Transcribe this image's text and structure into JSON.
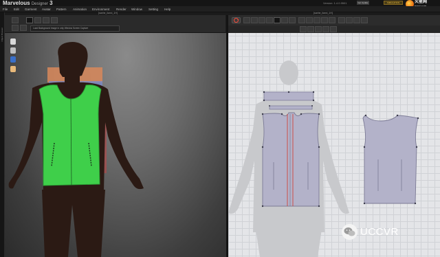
{
  "app": {
    "name": "Marvelous",
    "suffix": "Designer",
    "version_num": "3",
    "version_text": "Version: 1.4.0.9501",
    "user_label": "Get Update",
    "mode_label": "SIMULATION",
    "watermark_logo": "火星网",
    "watermark_url": "hxsd.com"
  },
  "menu": [
    "File",
    "Edit",
    "Garment",
    "Avatar",
    "Pattern",
    "Animation",
    "Environment",
    "Render",
    "Window",
    "Setting",
    "Help"
  ],
  "left_strip_label": "Object Browser",
  "viewports": {
    "view3d_title": "[sanhe_lianxi_1H]",
    "view2d_title": "[sanhe_lianxi_1H]",
    "view3d_status": "Load Background Image in only Window Screen Capture"
  },
  "watermark": {
    "text": "UCCVR",
    "icon": "wechat-icon"
  },
  "colors": {
    "garment_3d": "#3fcf4a",
    "pattern_fill": "#b3b2c9",
    "pattern_stroke": "#7b7a95",
    "seam_red": "#d0443a",
    "background_2d": "#e4e5e8"
  },
  "toolbar3d_icons": [
    "select-icon",
    "move-icon",
    "fold-icon",
    "pin-icon",
    "tack-icon"
  ],
  "toolbar2d_icons": [
    "simulation-icon",
    "transform-icon",
    "edit-point-icon",
    "internal-line-icon",
    "segment-icon",
    "polygon-icon",
    "rectangle-icon",
    "circle-icon",
    "dart-icon",
    "seam-icon",
    "free-seam-icon",
    "tack-icon",
    "fold-icon",
    "pattern-symmetry-icon",
    "trace-icon",
    "texture-icon",
    "grid-icon",
    "zoom-icon"
  ]
}
